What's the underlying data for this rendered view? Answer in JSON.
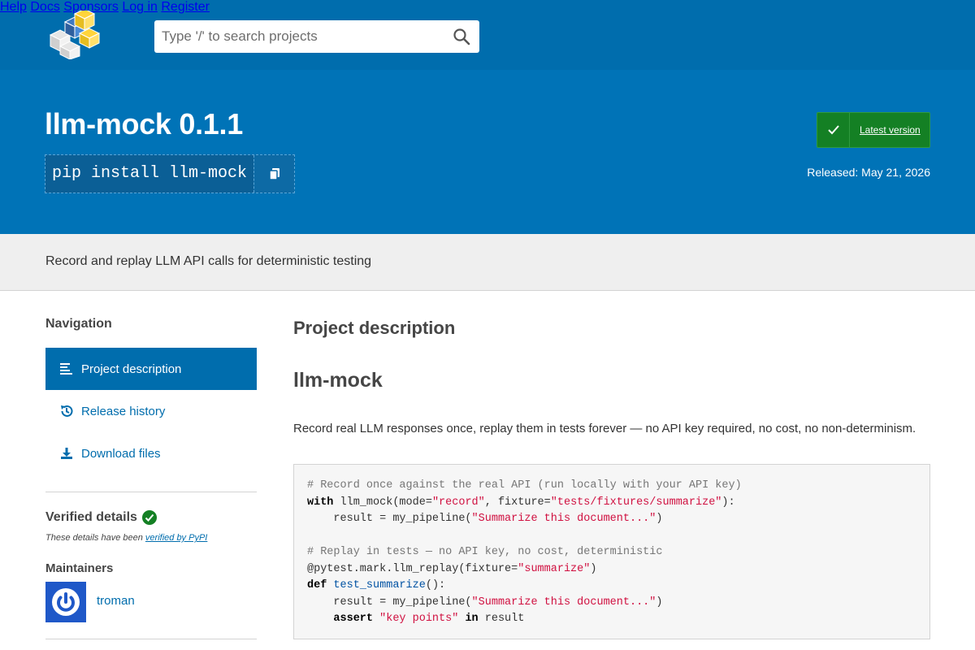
{
  "header": {
    "search_placeholder": "Type '/' to search projects",
    "nav": [
      "Help",
      "Docs",
      "Sponsors",
      "Log in",
      "Register"
    ]
  },
  "hero": {
    "title": "llm-mock 0.1.1",
    "pip_command": "pip install llm-mock",
    "latest_label": "Latest version",
    "released": "Released: May 21, 2026"
  },
  "summary": "Record and replay LLM API calls for deterministic testing",
  "sidebar": {
    "navigation_heading": "Navigation",
    "items": [
      {
        "label": "Project description",
        "icon": "align-left-icon",
        "active": true
      },
      {
        "label": "Release history",
        "icon": "history-icon",
        "active": false
      },
      {
        "label": "Download files",
        "icon": "download-icon",
        "active": false
      }
    ],
    "verified_heading": "Verified details",
    "verified_note_prefix": "These details have been ",
    "verified_note_link": "verified by PyPI",
    "maintainers_heading": "Maintainers",
    "maintainer": "troman"
  },
  "main": {
    "heading": "Project description",
    "readme_title": "llm-mock",
    "intro": "Record real LLM responses once, replay them in tests forever — no API key required, no cost, no non-determinism.",
    "code": {
      "l1": "# Record once against the real API (run locally with your API key)",
      "l2_kw": "with",
      "l2_a": " llm_mock(mode=",
      "l2_s1": "\"record\"",
      "l2_b": ", fixture=",
      "l2_s2": "\"tests/fixtures/summarize\"",
      "l2_c": "):",
      "l3_a": "    result = my_pipeline(",
      "l3_s": "\"Summarize this document...\"",
      "l3_b": ")",
      "l5": "# Replay in tests — no API key, no cost, deterministic",
      "l6_a": "@pytest.mark.llm_replay(fixture=",
      "l6_s": "\"summarize\"",
      "l6_b": ")",
      "l7_kw": "def",
      "l7_fn": "test_summarize",
      "l7_b": "():",
      "l8_a": "    result = my_pipeline(",
      "l8_s": "\"Summarize this document...\"",
      "l8_b": ")",
      "l9_kw": "assert",
      "l9_s": "\"key points\"",
      "l9_kw2": "in",
      "l9_b": " result"
    }
  },
  "colors": {
    "header_blue": "#006dad",
    "hero_blue": "#0073b7",
    "latest_green": "#148024"
  }
}
